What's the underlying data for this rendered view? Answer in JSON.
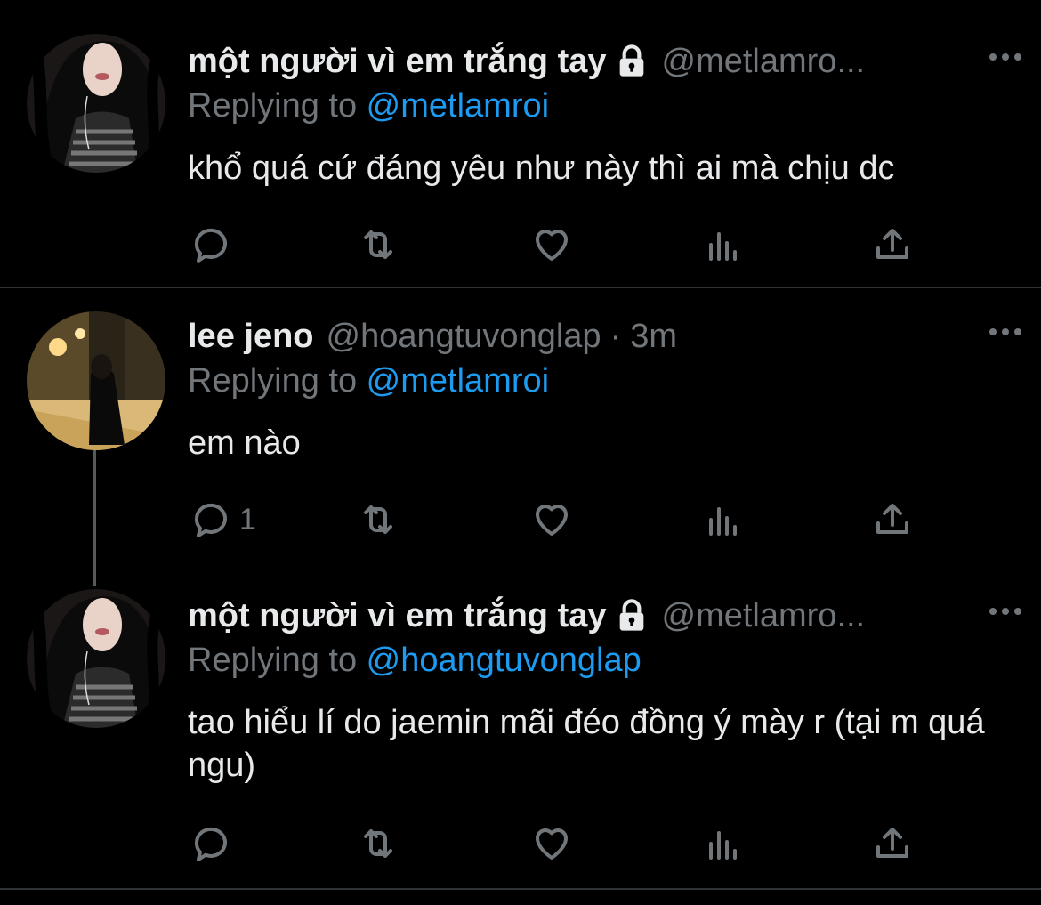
{
  "tweets": [
    {
      "name": "một người vì em trắng tay",
      "handle": "@metlamro...",
      "time": "",
      "replying_prefix": "Replying to ",
      "replying_to": "@metlamroi",
      "text": "khổ quá cứ đáng yêu như này thì ai mà chịu dc",
      "reply_count": "",
      "locked": true,
      "avatar": "dark-hair-avatar"
    },
    {
      "name": "lee jeno",
      "handle": "@hoangtuvonglap",
      "time": "3m",
      "replying_prefix": "Replying to ",
      "replying_to": "@metlamroi",
      "text": "em nào",
      "reply_count": "1",
      "locked": false,
      "avatar": "night-street-avatar"
    },
    {
      "name": "một người vì em trắng tay",
      "handle": "@metlamro...",
      "time": "",
      "replying_prefix": "Replying to ",
      "replying_to": "@hoangtuvonglap",
      "text": "tao hiểu lí do jaemin mãi đéo đồng ý mày r (tại m quá ngu)",
      "reply_count": "",
      "locked": true,
      "avatar": "dark-hair-avatar"
    }
  ],
  "colors": {
    "background": "#000000",
    "text": "#e7e9ea",
    "muted": "#71767b",
    "link": "#1d9bf0",
    "divider": "#2f3336"
  }
}
